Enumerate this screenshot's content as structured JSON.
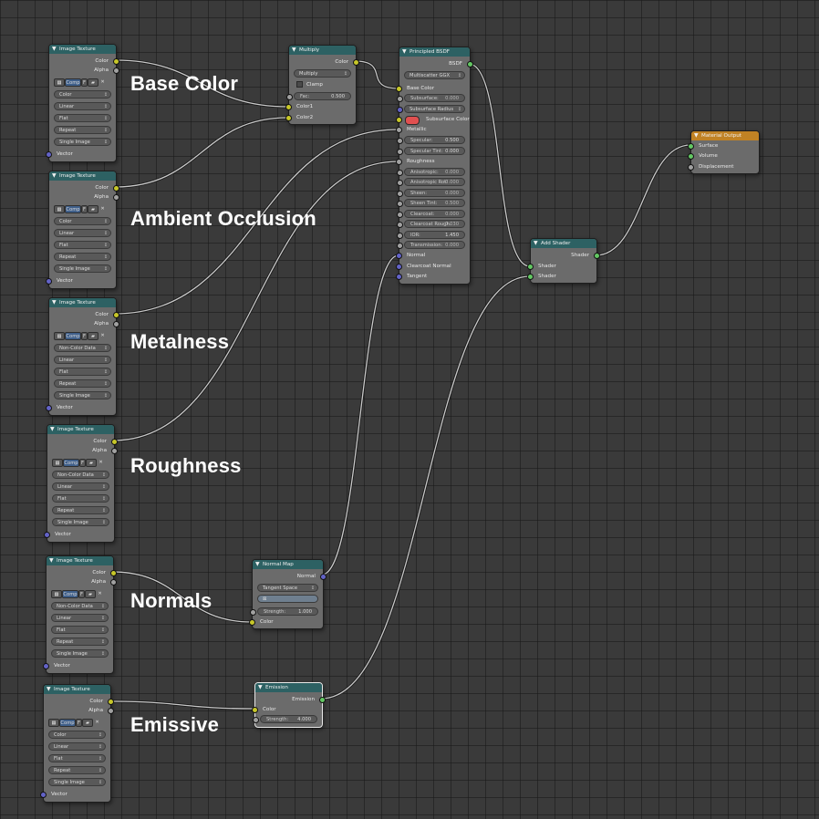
{
  "section_labels": {
    "base_color": "Base Color",
    "ambient_occlusion": "Ambient Occlusion",
    "metalness": "Metalness",
    "roughness": "Roughness",
    "normals": "Normals",
    "emissive": "Emissive"
  },
  "image_texture": {
    "title": "Image Texture",
    "out_color": "Color",
    "out_alpha": "Alpha",
    "in_vector": "Vector",
    "image_field": "Comp",
    "image_users": "F",
    "interpolation": "Linear",
    "projection": "Flat",
    "extension": "Repeat",
    "source": "Single Image",
    "color_space_color": "Color",
    "color_space_noncolor": "Non-Color Data"
  },
  "multiply": {
    "title": "Multiply",
    "out_color": "Color",
    "blend_type": "Multiply",
    "clamp": "Clamp",
    "fac_label": "Fac:",
    "fac_value": "0.500",
    "in_color1": "Color1",
    "in_color2": "Color2"
  },
  "principled": {
    "title": "Principled BSDF",
    "out_bsdf": "BSDF",
    "distribution": "Multiscatter GGX",
    "base_color": "Base Color",
    "subsurface_label": "Subsurface:",
    "subsurface_value": "0.000",
    "subsurface_radius": "Subsurface Radius",
    "subsurface_color": "Subsurface Color",
    "metallic": "Metallic",
    "specular_label": "Specular:",
    "specular_value": "0.500",
    "specular_tint_label": "Specular Tint:",
    "specular_tint_value": "0.000",
    "roughness": "Roughness",
    "anisotropic_label": "Anisotropic:",
    "anisotropic_value": "0.000",
    "anisotropic_rot_label": "Anisotropic Rot:",
    "anisotropic_rot_value": "0.000",
    "sheen_label": "Sheen:",
    "sheen_value": "0.000",
    "sheen_tint_label": "Sheen Tint:",
    "sheen_tint_value": "0.500",
    "clearcoat_label": "Clearcoat:",
    "clearcoat_value": "0.000",
    "clearcoat_rough_label": "Clearcoat Rough:",
    "clearcoat_rough_value": "0.030",
    "ior_label": "IOR:",
    "ior_value": "1.450",
    "transmission_label": "Transmission:",
    "transmission_value": "0.000",
    "normal": "Normal",
    "clearcoat_normal": "Clearcoat Normal",
    "tangent": "Tangent"
  },
  "add_shader": {
    "title": "Add Shader",
    "out_shader": "Shader",
    "in_shader_1": "Shader",
    "in_shader_2": "Shader"
  },
  "material_output": {
    "title": "Material Output",
    "surface": "Surface",
    "volume": "Volume",
    "displacement": "Displacement"
  },
  "normal_map": {
    "title": "Normal Map",
    "out_normal": "Normal",
    "space": "Tangent Space",
    "strength_label": "Strength:",
    "strength_value": "1.000",
    "in_color": "Color"
  },
  "emission": {
    "title": "Emission",
    "out_emission": "Emission",
    "in_color": "Color",
    "strength_label": "Strength:",
    "strength_value": "4.000"
  },
  "colors": {
    "canvas": "#3a3a3a",
    "node_body": "#6b6b6b",
    "header_shader": "#2d6163",
    "header_output": "#c08224",
    "socket_color": "#c7c729",
    "socket_float": "#a1a1a1",
    "socket_vector": "#6363c7",
    "socket_shader": "#63c763",
    "subsurface_swatch": "#e05050"
  }
}
